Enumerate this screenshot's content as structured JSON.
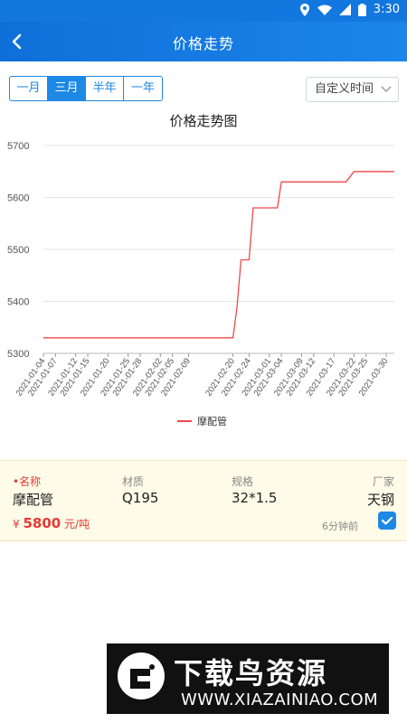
{
  "status": {
    "time": "3:30"
  },
  "header": {
    "title": "价格走势"
  },
  "range_tabs": [
    "一月",
    "三月",
    "半年",
    "一年"
  ],
  "active_tab": 1,
  "custom_time": "自定义时间",
  "chart_data": {
    "type": "line",
    "title": "价格走势图",
    "x": [
      "2021-01-04",
      "2021-01-07",
      "2021-01-12",
      "2021-01-15",
      "2021-01-20",
      "2021-01-25",
      "2021-01-28",
      "2021-02-02",
      "2021-02-05",
      "2021-02-09",
      "2021-02-20",
      "2021-02-24",
      "2021-03-01",
      "2021-03-04",
      "2021-03-09",
      "2021-03-12",
      "2021-03-17",
      "2021-03-22",
      "2021-03-25",
      "2021-03-30"
    ],
    "y_ticks": [
      5300,
      5400,
      5500,
      5600,
      5700
    ],
    "ylim": [
      5300,
      5700
    ],
    "legend_position": "bottom",
    "grid": true,
    "series": [
      {
        "name": "摩配管",
        "color": "#f04848",
        "points": [
          [
            "2021-01-04",
            5330
          ],
          [
            "2021-02-20",
            5330
          ],
          [
            "2021-02-21",
            5390
          ],
          [
            "2021-02-22",
            5480
          ],
          [
            "2021-02-24",
            5480
          ],
          [
            "2021-02-25",
            5580
          ],
          [
            "2021-03-03",
            5580
          ],
          [
            "2021-03-04",
            5630
          ],
          [
            "2021-03-20",
            5630
          ],
          [
            "2021-03-22",
            5650
          ],
          [
            "2021-04-01",
            5650
          ]
        ]
      }
    ]
  },
  "product": {
    "name_label": "•名称",
    "name": "摩配管",
    "material_label": "材质",
    "material": "Q195",
    "spec_label": "规格",
    "spec": "32*1.5",
    "maker_label": "厂家",
    "maker": "天钢",
    "price_symbol": "¥",
    "price": "5800",
    "price_unit": "元/吨",
    "updated": "6分钟前"
  },
  "watermark": {
    "title": "下载鸟资源",
    "url": "WWW.XIAZAINIAO.COM"
  }
}
